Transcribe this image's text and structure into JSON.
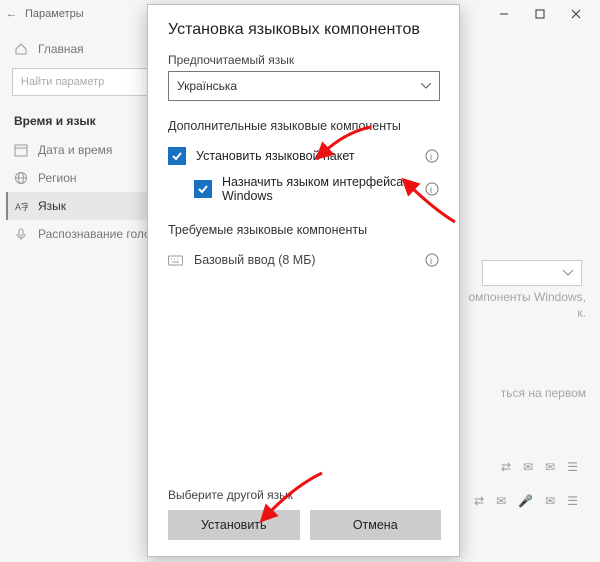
{
  "bg": {
    "title": "Параметры",
    "back": "←",
    "home": "Главная",
    "search_placeholder": "Найти параметр",
    "section": "Время и язык",
    "items": [
      {
        "label": "Дата и время"
      },
      {
        "label": "Регион"
      },
      {
        "label": "Язык"
      },
      {
        "label": "Распознавание голоса"
      }
    ],
    "rp1": "омпоненты Windows,",
    "rp2": "к.",
    "rp3": "ться на первом"
  },
  "modal": {
    "title": "Установка языковых компонентов",
    "pref_label": "Предпочитаемый язык",
    "selected_lang": "Українська",
    "optional_section": "Дополнительные языковые компоненты",
    "opt1": "Установить языковой пакет",
    "opt2": "Назначить языком интерфейса Windows",
    "required_section": "Требуемые языковые компоненты",
    "req1": "Базовый ввод (8 МБ)",
    "other_lang": "Выберите другой язык",
    "install": "Установить",
    "cancel": "Отмена"
  },
  "controls": {
    "min": "—",
    "max": "☐",
    "close": "✕"
  }
}
